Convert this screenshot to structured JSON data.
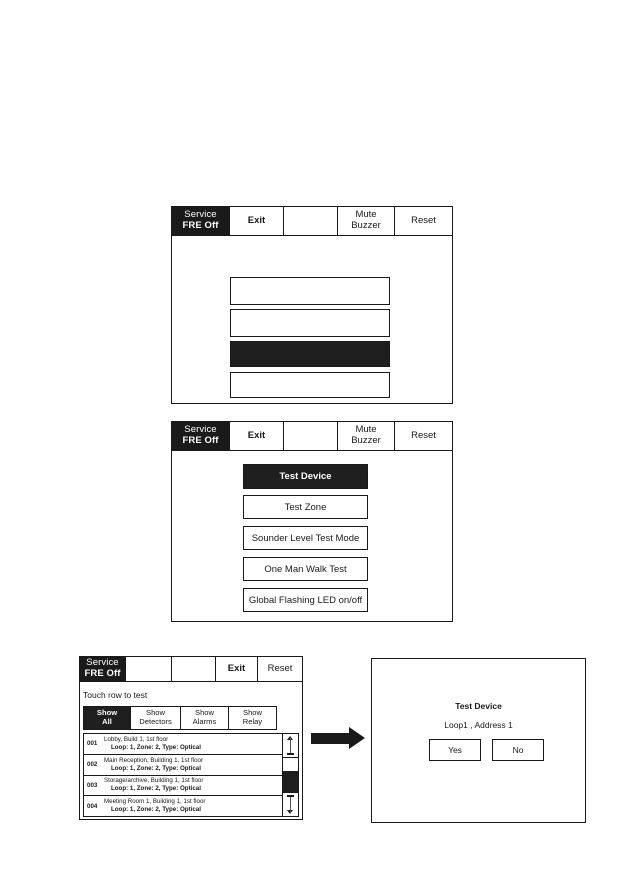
{
  "status_bar": {
    "line1": "Service",
    "line2_bold": "FRE",
    "line2_rest": "Off"
  },
  "panel1": {
    "topbar": [
      {
        "type": "status",
        "line1": "Service",
        "line2": "FRE Off"
      },
      {
        "type": "button",
        "label": "Exit",
        "bold": true
      },
      {
        "type": "button",
        "label": ""
      },
      {
        "type": "button",
        "label": "Mute Buzzer",
        "line1": "Mute",
        "line2": "Buzzer"
      },
      {
        "type": "button",
        "label": "Reset"
      }
    ],
    "menu_items": [
      {
        "label": "",
        "selected": false
      },
      {
        "label": "",
        "selected": false
      },
      {
        "label": "",
        "selected": true
      },
      {
        "label": "",
        "selected": false
      }
    ]
  },
  "panel2": {
    "topbar": [
      {
        "type": "status",
        "line1": "Service",
        "line2": "FRE Off"
      },
      {
        "type": "button",
        "label": "Exit",
        "bold": true
      },
      {
        "type": "button",
        "label": ""
      },
      {
        "type": "button",
        "label": "Mute Buzzer",
        "line1": "Mute",
        "line2": "Buzzer"
      },
      {
        "type": "button",
        "label": "Reset"
      }
    ],
    "menu_items": [
      {
        "label": "Test Device",
        "selected": true
      },
      {
        "label": "Test Zone",
        "selected": false
      },
      {
        "label": "Sounder Level Test Mode",
        "selected": false
      },
      {
        "label": "One Man Walk Test",
        "selected": false
      },
      {
        "label": "Global Flashing LED on/off",
        "selected": false
      }
    ]
  },
  "panel3": {
    "topbar": [
      {
        "type": "status",
        "line1": "Service",
        "line2": "FRE Off"
      },
      {
        "type": "button",
        "label": ""
      },
      {
        "type": "button",
        "label": ""
      },
      {
        "type": "button",
        "label": "Exit",
        "bold": true
      },
      {
        "type": "button",
        "label": "Reset"
      }
    ],
    "hint": "Touch row to test",
    "tabs": [
      {
        "line1": "Show",
        "line2": "All",
        "active": true
      },
      {
        "line1": "Show",
        "line2": "Detectors",
        "active": false
      },
      {
        "line1": "Show",
        "line2": "Alarms",
        "active": false
      },
      {
        "line1": "Show",
        "line2": "Relay",
        "active": false
      }
    ],
    "rows": [
      {
        "id": "001",
        "line1": "Lobby, Build 1, 1st floor",
        "line2": "Loop: 1, Zone: 2, Type: Optical"
      },
      {
        "id": "002",
        "line1": "Main Reception, Building 1, 1st floor",
        "line2": "Loop: 1, Zone: 2, Type: Optical"
      },
      {
        "id": "003",
        "line1": "Storage/archive, Building 1, 1st floor",
        "line2": "Loop: 1, Zone: 2, Type: Optical"
      },
      {
        "id": "004",
        "line1": "Meeting Room 1, Building 1, 1st floor",
        "line2": "Loop: 1, Zone: 2, Type: Optical"
      }
    ],
    "scroll_up_icon": "scroll-up-arrow-icon",
    "scroll_down_icon": "scroll-down-arrow-icon"
  },
  "flow_arrow_icon": "flow-right-arrow-icon",
  "dialog": {
    "title": "Test Device",
    "subtitle": "Loop1 , Address 1",
    "yes_label": "Yes",
    "no_label": "No"
  },
  "colors": {
    "ink": "#1a1a1a",
    "fill": "#1f1f1f",
    "paper": "#ffffff"
  }
}
